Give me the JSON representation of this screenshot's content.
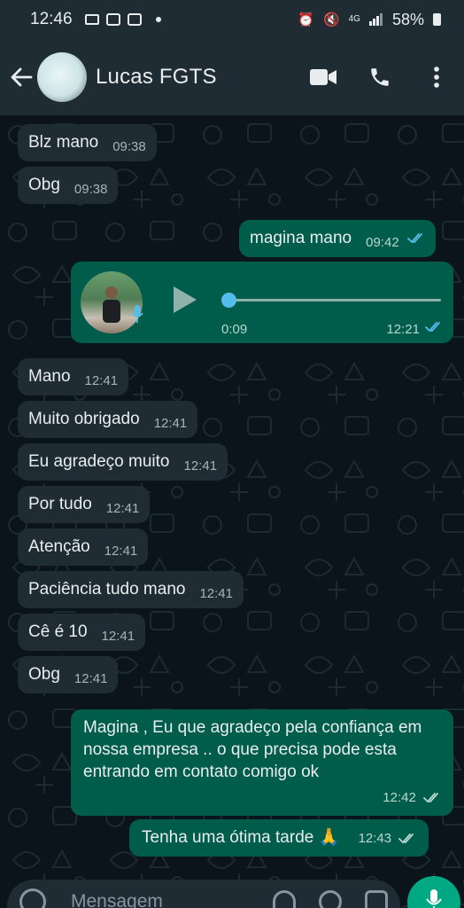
{
  "status_bar": {
    "time": "12:46",
    "battery": "58%",
    "network": "4G"
  },
  "header": {
    "contact_name": "Lucas FGTS"
  },
  "messages": [
    {
      "text": "Blz mano",
      "time": "09:38"
    },
    {
      "text": "Obg",
      "time": "09:38"
    },
    {
      "text": "magina mano",
      "time": "09:42"
    },
    {
      "text": "Mano",
      "time": "12:41"
    },
    {
      "text": "Muito obrigado",
      "time": "12:41"
    },
    {
      "text": "Eu agradeço muito",
      "time": "12:41"
    },
    {
      "text": "Por tudo",
      "time": "12:41"
    },
    {
      "text": "Atenção",
      "time": "12:41"
    },
    {
      "text": "Paciência tudo mano",
      "time": "12:41"
    },
    {
      "text": "Cê é 10",
      "time": "12:41"
    },
    {
      "text": "Obg",
      "time": "12:41"
    },
    {
      "text": "Magina , Eu que agradeço pela confiança em nossa empresa .. o que precisa pode esta entrando em contato comigo ok",
      "time": "12:42"
    },
    {
      "text": "Tenha uma ótima tarde 🙏",
      "time": "12:43"
    }
  ],
  "audio": {
    "duration": "0:09",
    "time": "12:21",
    "progress": 0
  },
  "input": {
    "placeholder": "Mensagem"
  },
  "colors": {
    "incoming": "#1f2c34",
    "outgoing": "#005c4b",
    "read_tick": "#53bdeb",
    "accent": "#00a884"
  }
}
